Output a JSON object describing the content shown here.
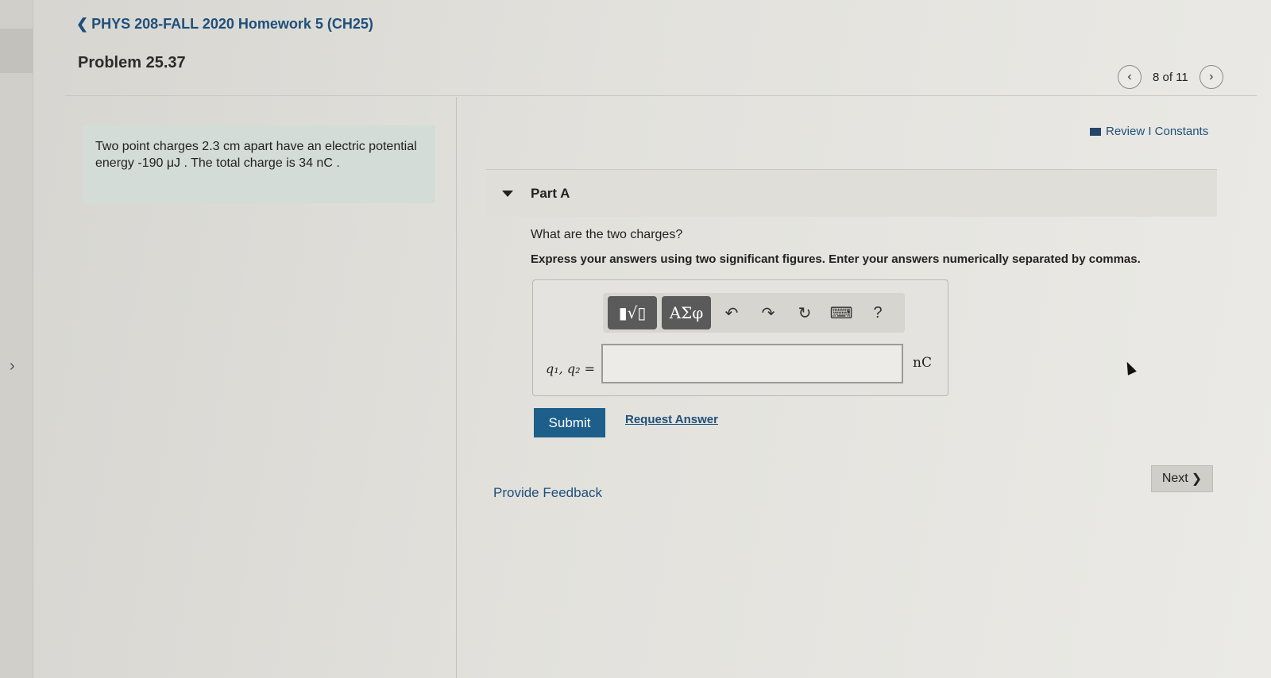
{
  "header": {
    "back_label": "PHYS 208-FALL 2020 Homework 5 (CH25)",
    "problem_title": "Problem 25.37",
    "pager": {
      "count": "8 of 11"
    }
  },
  "info": {
    "text": "Two point charges 2.3 cm apart have an electric potential energy -190 μJ . The total charge is 34 nC ."
  },
  "links": {
    "review": "Review I Constants"
  },
  "part": {
    "label": "Part A",
    "question": "What are the two charges?",
    "instructions": "Express your answers using two significant figures. Enter your answers numerically separated by commas.",
    "input_label": "q₁, q₂ =",
    "input_value": "",
    "unit": "nC",
    "toolbar": {
      "templates_label": "▮√▯",
      "greek_label": "ΑΣφ",
      "help_label": "?"
    }
  },
  "actions": {
    "submit": "Submit",
    "request_answer": "Request Answer",
    "provide_feedback": "Provide Feedback",
    "next": "Next"
  },
  "icons": {
    "back": "chevron-left-icon",
    "prev": "chevron-left-icon",
    "next": "chevron-right-icon",
    "undo": "undo-icon",
    "redo": "redo-icon",
    "reset": "reset-icon",
    "keyboard": "keyboard-icon"
  },
  "colors": {
    "link": "#1f4f7a",
    "submit_bg": "#1d5f8a",
    "info_bg": "#d3dcd6"
  }
}
